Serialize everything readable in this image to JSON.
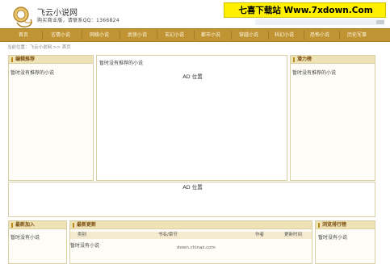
{
  "header": {
    "site_title": "飞云小说网",
    "site_subtitle": "购买商业版，请联系QQ：1366824",
    "watermark": "七喜下载站 Www.7xdown.Com"
  },
  "nav": {
    "items": [
      "首页",
      "言情小说",
      "网络小说",
      "武侠小说",
      "玄幻小说",
      "都市小说",
      "穿越小说",
      "科幻小说",
      "恐怖小说",
      "历史军事"
    ]
  },
  "breadcrumb": "当前位置：飞云小说网 >> 首页",
  "left_panel": {
    "title": "编辑推荐",
    "empty_text": "暂时没有推荐的小说"
  },
  "center_panel": {
    "empty_text": "暂时没有推荐的小说",
    "ad_text": "AD 位置"
  },
  "right_panel": {
    "title": "潜力榜",
    "empty_text": "暂时没有推荐的小说"
  },
  "banner_ad": {
    "ad_text": "AD 位置"
  },
  "new_added": {
    "title": "最新加入",
    "empty_text": "暂时没有小说"
  },
  "latest_updates": {
    "title": "最新更新",
    "columns": [
      "类别",
      "书名/章节",
      "作者",
      "更新时间"
    ],
    "empty_text": "暂时没有小说",
    "site_mark": "down.chinaz.com"
  },
  "views_rank": {
    "title": "浏览排行榜",
    "empty_text": "暂时没有小说"
  }
}
